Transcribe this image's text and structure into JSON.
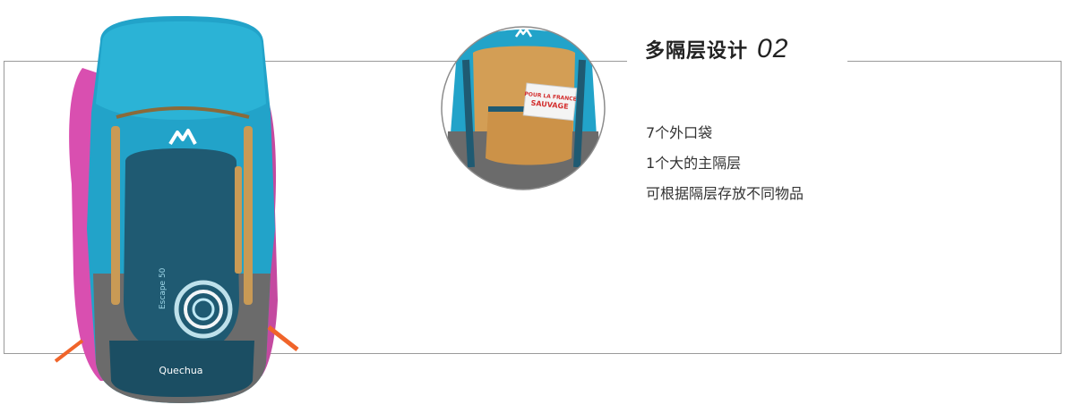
{
  "section": {
    "title": "多隔层设计",
    "number": "02"
  },
  "features": [
    "7个外口袋",
    "1个大的主隔层",
    "可根据隔层存放不同物品"
  ],
  "brand": {
    "logo_text": "Quechua",
    "model_text": "Escape 50",
    "card_text_line1": "POUR LA FRANCE",
    "card_text_line2": "SAUVAGE"
  },
  "colors": {
    "accent": "#22a3c9",
    "navy": "#1f5a72",
    "pink": "#d94fb0",
    "gray": "#6b6b6b",
    "tan": "#c99a55",
    "frame": "#9a9a9a"
  }
}
